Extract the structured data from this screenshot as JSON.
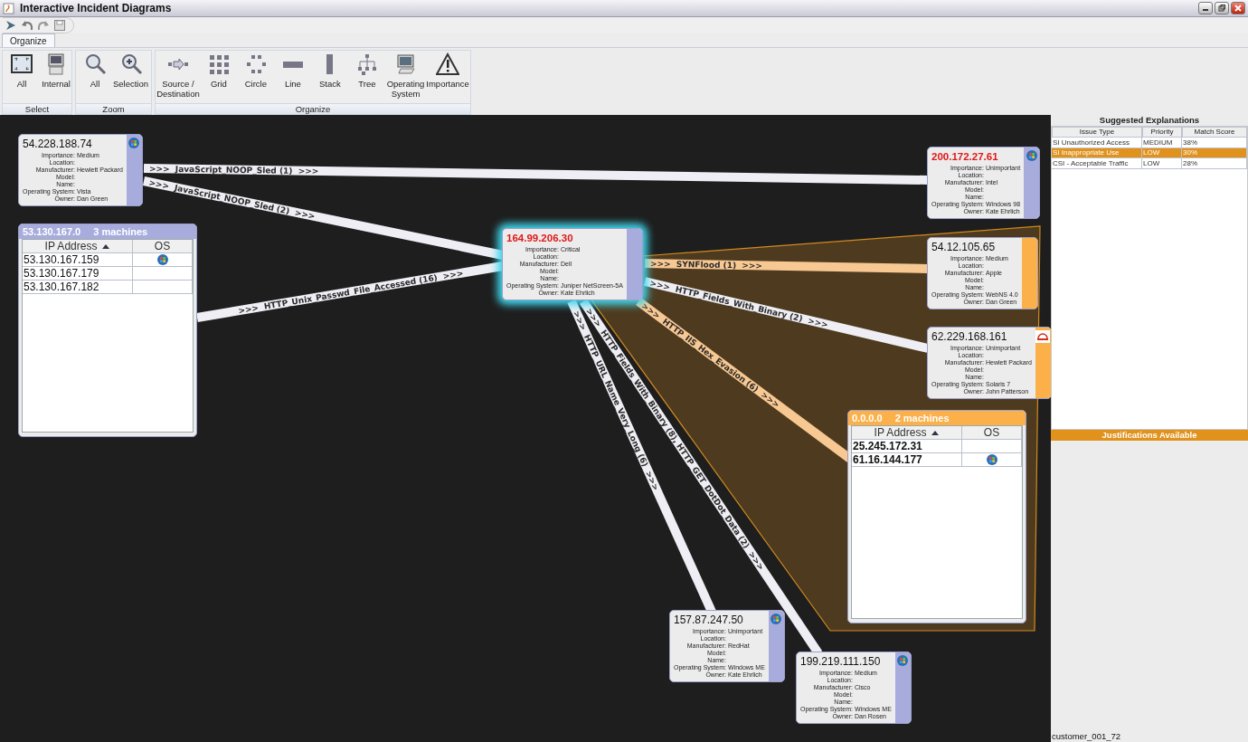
{
  "window": {
    "title": "Interactive Incident Diagrams"
  },
  "ribbon": {
    "tabs": [
      {
        "label": "Organize",
        "selected": true
      }
    ],
    "groups": [
      {
        "label": "Select",
        "buttons": [
          "All",
          "Internal"
        ]
      },
      {
        "label": "Zoom",
        "buttons": [
          "All",
          "Selection"
        ]
      },
      {
        "label": "Organize",
        "buttons": [
          "Source /\nDestination",
          "Grid",
          "Circle",
          "Line",
          "Stack",
          "Tree",
          "Operating\nSystem",
          "Importance"
        ]
      }
    ]
  },
  "diagram": {
    "region": {
      "color": "#4e3b1f"
    },
    "edges": [
      {
        "label": ">>>  JavaScript_NOOP_Sled (1)  >>>",
        "color": "#eeeef4"
      },
      {
        "label": ">>>  JavaScript_NOOP_Sled (2)  >>>",
        "color": "#eeeef4"
      },
      {
        "label": ">>>  HTTP_Unix_Passwd_File_Accessed (16)  >>>",
        "color": "#eeeef4"
      },
      {
        "label": ">>>  SYNFlood (1)  >>>",
        "color": "#f8c893"
      },
      {
        "label": ">>>  HTTP_Fields_With_Binary (2)  >>>",
        "color": "#eeeef4"
      },
      {
        "label": ">>>  HTTP_IIS_Hex_Evasion (6)  >>>",
        "color": "#f8c893"
      },
      {
        "label": ">>>  HTTP_Fields_With_Binary (8), HTTP_GET_DotDot_Data (2)  >>>",
        "color": "#eeeef4"
      },
      {
        "label": ">>>  HTTP_URL_Name_Very_Long (6)  >>>",
        "color": "#eeeef4"
      }
    ],
    "nodes": [
      {
        "ip": "54.228.188.74",
        "alert": false,
        "selected": false,
        "color": "#a7acdc",
        "kind": "windows",
        "details": [
          {
            "label": "Importance:",
            "value": "Medium"
          },
          {
            "label": "Location:"
          },
          {
            "label": "Manufacturer:",
            "value": "Hewlett Packard"
          },
          {
            "label": "Model:"
          },
          {
            "label": "Name:"
          },
          {
            "label": "Operating System:",
            "value": "Vista"
          },
          {
            "label": "Owner:",
            "value": "Dan Green"
          }
        ]
      },
      {
        "ip": "200.172.27.61",
        "alert": true,
        "selected": false,
        "color": "#a7acdc",
        "kind": "windows",
        "details": [
          {
            "label": "Importance:",
            "value": "Unimportant"
          },
          {
            "label": "Location:"
          },
          {
            "label": "Manufacturer:",
            "value": "Intel"
          },
          {
            "label": "Model:"
          },
          {
            "label": "Name:"
          },
          {
            "label": "Operating System:",
            "value": "Windows 98"
          },
          {
            "label": "Owner:",
            "value": "Kate Ehrlich"
          }
        ]
      },
      {
        "ip": "164.99.206.30",
        "alert": true,
        "selected": true,
        "color": "#a7acdc",
        "kind": "plain",
        "details": [
          {
            "label": "Importance:",
            "value": "Critical"
          },
          {
            "label": "Location:"
          },
          {
            "label": "Manufacturer:",
            "value": "Dell"
          },
          {
            "label": "Model:"
          },
          {
            "label": "Name:"
          },
          {
            "label": "Operating System:",
            "value": "Juniper NetScreen-5A"
          },
          {
            "label": "Owner:",
            "value": "Kate Ehrlich"
          }
        ]
      },
      {
        "ip": "54.12.105.65",
        "alert": false,
        "selected": false,
        "color": "#fbb04a",
        "kind": "plain",
        "details": [
          {
            "label": "Importance:",
            "value": "Medium"
          },
          {
            "label": "Location:"
          },
          {
            "label": "Manufacturer:",
            "value": "Apple"
          },
          {
            "label": "Model:"
          },
          {
            "label": "Name:"
          },
          {
            "label": "Operating System:",
            "value": "WebNS 4.0"
          },
          {
            "label": "Owner:",
            "value": "Dan Green"
          }
        ]
      },
      {
        "ip": "62.229.168.161",
        "alert": false,
        "selected": false,
        "color": "#fbb04a",
        "kind": "solaris",
        "details": [
          {
            "label": "Importance:",
            "value": "Unimportant"
          },
          {
            "label": "Location:"
          },
          {
            "label": "Manufacturer:",
            "value": "Hewlett Packard"
          },
          {
            "label": "Model:"
          },
          {
            "label": "Name:"
          },
          {
            "label": "Operating System:",
            "value": "Solaris 7"
          },
          {
            "label": "Owner:",
            "value": "John Patterson"
          }
        ]
      },
      {
        "ip": "157.87.247.50",
        "alert": false,
        "selected": false,
        "color": "#a7acdc",
        "kind": "windows",
        "details": [
          {
            "label": "Importance:",
            "value": "Unimportant"
          },
          {
            "label": "Location:"
          },
          {
            "label": "Manufacturer:",
            "value": "RedHat"
          },
          {
            "label": "Model:"
          },
          {
            "label": "Name:"
          },
          {
            "label": "Operating System:",
            "value": "Windows ME"
          },
          {
            "label": "Owner:",
            "value": "Kate Ehrlich"
          }
        ]
      },
      {
        "ip": "199.219.111.150",
        "alert": false,
        "selected": false,
        "color": "#a7acdc",
        "kind": "windows",
        "details": [
          {
            "label": "Importance:",
            "value": "Medium"
          },
          {
            "label": "Location:"
          },
          {
            "label": "Manufacturer:",
            "value": "Cisco"
          },
          {
            "label": "Model:"
          },
          {
            "label": "Name:"
          },
          {
            "label": "Operating System:",
            "value": "Windows ME"
          },
          {
            "label": "Owner:",
            "value": "Dan Rosen"
          }
        ]
      }
    ],
    "groups": [
      {
        "subnet": "53.130.167.0",
        "count": "3 machines",
        "color": "#a7acdc",
        "bold": false,
        "columns": [
          "IP Address",
          "OS"
        ],
        "rows": [
          {
            "ip": "53.130.167.159",
            "os_logo": true
          },
          {
            "ip": "53.130.167.179",
            "os_logo": false
          },
          {
            "ip": "53.130.167.182",
            "os_logo": false
          }
        ]
      },
      {
        "subnet": "0.0.0.0",
        "count": "2 machines",
        "color": "#fbb04a",
        "bold": true,
        "columns": [
          "IP Address",
          "OS"
        ],
        "rows": [
          {
            "ip": "25.245.172.31",
            "os_logo": false
          },
          {
            "ip": "61.16.144.177",
            "os_logo": true
          }
        ]
      }
    ]
  },
  "explanations": {
    "title": "Suggested Explanations",
    "columns": [
      "Issue Type",
      "Priority",
      "Match Score"
    ],
    "rows": [
      {
        "cells": [
          "SI Unauthorized Access",
          "MEDIUM",
          "38%"
        ],
        "selected": false
      },
      {
        "cells": [
          "SI Inappropriate Use",
          "LOW",
          "30%"
        ],
        "selected": true
      },
      {
        "cells": [
          "CSI - Acceptable Traffic",
          "LOW",
          "28%"
        ],
        "selected": false
      }
    ],
    "banner": "Justifications Available"
  },
  "footer": "customer_001_72"
}
